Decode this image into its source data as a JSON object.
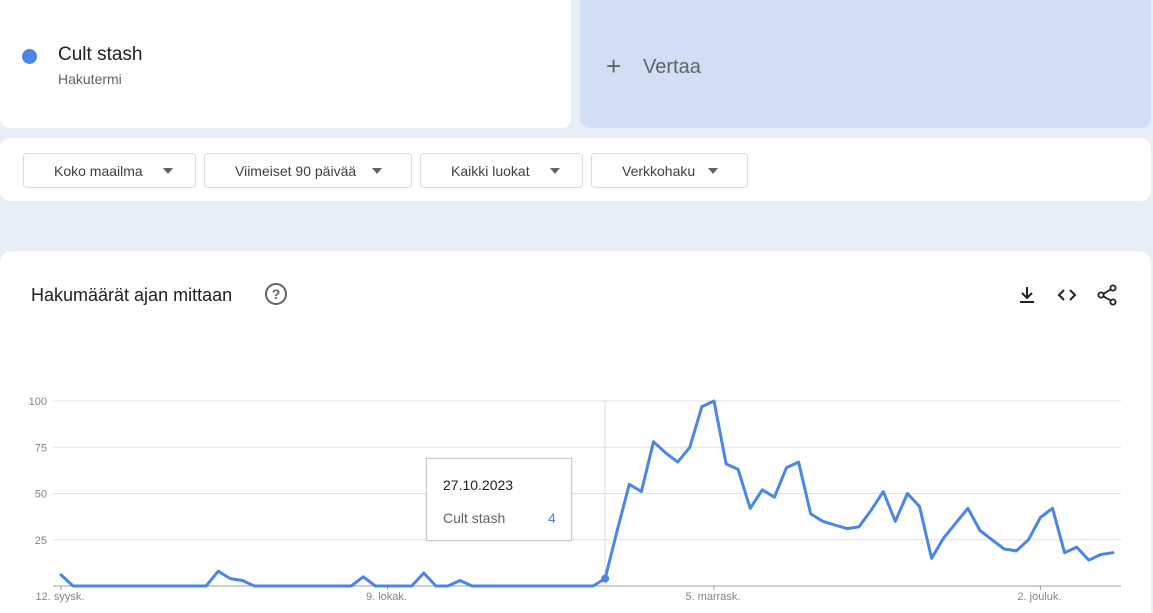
{
  "term": {
    "name": "Cult stash",
    "sub": "Hakutermi",
    "color": "#4a86e8"
  },
  "compare": {
    "plus": "+",
    "label": "Vertaa"
  },
  "filters": [
    {
      "label": "Koko maailma"
    },
    {
      "label": "Viimeiset 90 päivää"
    },
    {
      "label": "Kaikki luokat"
    },
    {
      "label": "Verkkohaku"
    }
  ],
  "panel": {
    "title": "Hakumäärät ajan mittaan",
    "help": "?",
    "icons": [
      "download-icon",
      "embed-code-icon",
      "share-icon"
    ]
  },
  "tooltip": {
    "date": "27.10.2023",
    "series": "Cult stash",
    "value": "4"
  },
  "chart_data": {
    "type": "line",
    "title": "",
    "xlabel": "",
    "ylabel": "",
    "ylim": [
      0,
      100
    ],
    "yticks": [
      25,
      50,
      75,
      100
    ],
    "x_tick_labels": [
      {
        "label": "12. syysk.",
        "index": 0
      },
      {
        "label": "9. lokak.",
        "index": 27
      },
      {
        "label": "5. marrask.",
        "index": 54
      },
      {
        "label": "2. jouluk.",
        "index": 81
      }
    ],
    "highlight_index": 45,
    "grid": true,
    "series": [
      {
        "color": "#4a86e8",
        "values": [
          6,
          0,
          0,
          0,
          0,
          0,
          0,
          0,
          0,
          0,
          0,
          0,
          0,
          8,
          4,
          3,
          0,
          0,
          0,
          0,
          0,
          0,
          0,
          0,
          0,
          5,
          0,
          0,
          0,
          0,
          7,
          0,
          0,
          3,
          0,
          0,
          0,
          0,
          0,
          0,
          0,
          0,
          0,
          0,
          0,
          4,
          30,
          55,
          51,
          78,
          72,
          67,
          75,
          97,
          100,
          66,
          63,
          42,
          52,
          48,
          64,
          67,
          39,
          35,
          33,
          31,
          32,
          41,
          51,
          35,
          50,
          43,
          15,
          26,
          34,
          42,
          30,
          25,
          20,
          19,
          25,
          37,
          42,
          18,
          21,
          14,
          17,
          18
        ]
      }
    ]
  }
}
